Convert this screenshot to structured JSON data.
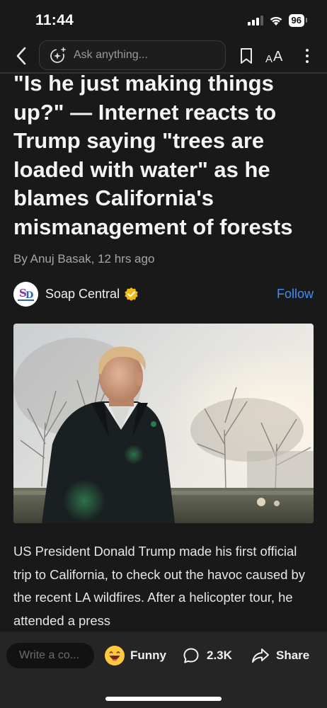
{
  "status_bar": {
    "time": "11:44",
    "battery": "96",
    "icons": [
      "signal-icon",
      "wifi-icon",
      "battery-icon"
    ]
  },
  "toolbar": {
    "ask_placeholder": "Ask anything...",
    "text_size_small": "A",
    "text_size_large": "A",
    "icons": [
      "back-icon",
      "sparkle-add-icon",
      "bookmark-icon",
      "text-size-icon",
      "more-icon"
    ]
  },
  "article": {
    "headline": "\"Is he just making things up?\" — Internet reacts to Trump saying \"trees are loaded with water\" as he blames California's mismanagement of forests",
    "byline": "By Anuj Basak, 12 hrs ago",
    "source": {
      "name": "Soap Central",
      "logo_text": "SC",
      "follow_label": "Follow",
      "verified": true
    },
    "image_icon": "photo-trump-outdoors",
    "body": "US President Donald Trump made his first official trip to California, to check out the havoc caused by the recent LA wildfires. After a helicopter tour, he attended a press"
  },
  "bottom_bar": {
    "comment_placeholder": "Write a co...",
    "reaction_label": "Funny",
    "comments_count": "2.3K",
    "share_label": "Share"
  },
  "colors": {
    "background": "#191919",
    "accent": "#3d8ff5",
    "verified": "#f2b90f",
    "bottom_bar": "#252525"
  }
}
